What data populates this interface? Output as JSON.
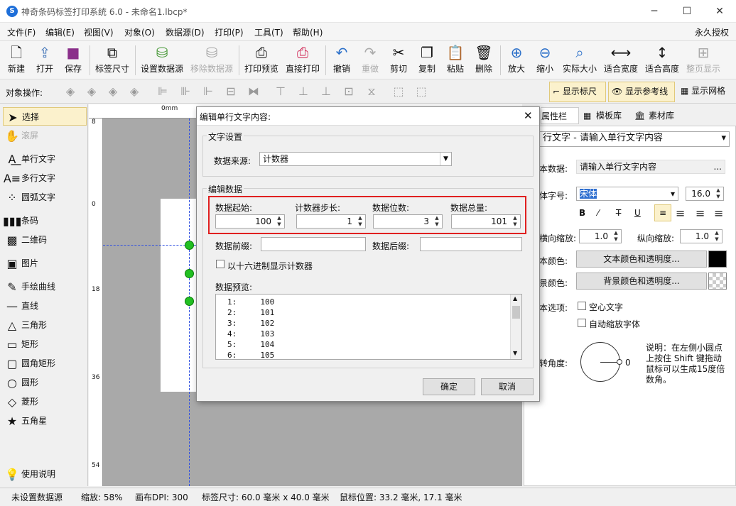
{
  "window": {
    "title": "神奇条码标签打印系统 6.0 - 未命名1.lbcp*",
    "icon": "app-logo-icon"
  },
  "menu": {
    "items": [
      "文件(F)",
      "编辑(E)",
      "视图(V)",
      "对象(O)",
      "数据源(D)",
      "打印(P)",
      "工具(T)",
      "帮助(H)"
    ],
    "right": "永久授权"
  },
  "toolbar": {
    "buttons": [
      {
        "label": "新建",
        "icon": "new-file-icon",
        "enabled": true
      },
      {
        "label": "打开",
        "icon": "open-icon",
        "enabled": true
      },
      {
        "label": "保存",
        "icon": "save-icon",
        "enabled": true
      },
      {
        "label": "标签尺寸",
        "icon": "label-size-icon",
        "enabled": true
      },
      {
        "label": "设置数据源",
        "icon": "database-icon",
        "enabled": true
      },
      {
        "label": "移除数据源",
        "icon": "database-remove-icon",
        "enabled": false
      },
      {
        "label": "打印预览",
        "icon": "print-preview-icon",
        "enabled": true
      },
      {
        "label": "直接打印",
        "icon": "printer-icon",
        "enabled": true
      },
      {
        "label": "撤销",
        "icon": "undo-icon",
        "enabled": true
      },
      {
        "label": "重做",
        "icon": "redo-icon",
        "enabled": false
      },
      {
        "label": "剪切",
        "icon": "cut-icon",
        "enabled": true
      },
      {
        "label": "复制",
        "icon": "copy-icon",
        "enabled": true
      },
      {
        "label": "粘贴",
        "icon": "paste-icon",
        "enabled": true
      },
      {
        "label": "删除",
        "icon": "delete-icon",
        "enabled": true
      },
      {
        "label": "放大",
        "icon": "zoom-in-icon",
        "enabled": true
      },
      {
        "label": "缩小",
        "icon": "zoom-out-icon",
        "enabled": true
      },
      {
        "label": "实际大小",
        "icon": "actual-size-icon",
        "enabled": true
      },
      {
        "label": "适合宽度",
        "icon": "fit-width-icon",
        "enabled": true
      },
      {
        "label": "适合高度",
        "icon": "fit-height-icon",
        "enabled": true
      },
      {
        "label": "整页显示",
        "icon": "full-page-icon",
        "enabled": false
      }
    ]
  },
  "objbar": {
    "label": "对象操作:",
    "show_ruler": "显示标尺",
    "show_guides": "显示参考线",
    "show_grid": "显示网格"
  },
  "tools": [
    {
      "label": "选择",
      "icon": "pointer-icon",
      "selected": true,
      "enabled": true
    },
    {
      "label": "滚屏",
      "icon": "hand-icon",
      "selected": false,
      "enabled": false
    },
    {
      "label": "单行文字",
      "icon": "single-line-text-icon"
    },
    {
      "label": "多行文字",
      "icon": "multi-line-text-icon"
    },
    {
      "label": "圆弧文字",
      "icon": "arc-text-icon"
    },
    {
      "label": "条码",
      "icon": "barcode-icon"
    },
    {
      "label": "二维码",
      "icon": "qrcode-icon"
    },
    {
      "label": "图片",
      "icon": "image-icon"
    },
    {
      "label": "手绘曲线",
      "icon": "pen-icon"
    },
    {
      "label": "直线",
      "icon": "line-icon"
    },
    {
      "label": "三角形",
      "icon": "triangle-icon"
    },
    {
      "label": "矩形",
      "icon": "rectangle-icon"
    },
    {
      "label": "圆角矩形",
      "icon": "rounded-rect-icon"
    },
    {
      "label": "圆形",
      "icon": "circle-icon"
    },
    {
      "label": "菱形",
      "icon": "diamond-icon"
    },
    {
      "label": "五角星",
      "icon": "star-icon"
    }
  ],
  "help": {
    "label": "使用说明",
    "icon": "lightbulb-icon"
  },
  "ruler": {
    "h_zero": "0mm",
    "v_labels": [
      "8",
      "0",
      "18",
      "36",
      "54"
    ]
  },
  "right_panel": {
    "tabs": [
      "属性栏",
      "模板库",
      "素材库"
    ],
    "object_select": "行文字 - 请输入单行文字内容",
    "text_data_label": "本数据:",
    "text_data": "请输入单行文字内容",
    "font_label": "体字号:",
    "font_value": "宋体",
    "font_size": "16.0",
    "hscale_label": "横向缩放:",
    "hscale": "1.0",
    "vscale_label": "纵向缩放:",
    "vscale": "1.0",
    "text_color_label": "本颜色:",
    "text_color_btn": "文本颜色和透明度...",
    "bg_color_label": "景颜色:",
    "bg_color_btn": "背景颜色和透明度...",
    "options_label": "本选项:",
    "hollow": "空心文字",
    "autoshrink": "自动缩放字体",
    "rotate_label": "转角度:",
    "rotate_value": "0",
    "note": "说明：在左侧小圆点上按住 Shift 键拖动鼠标可以生成15度倍数角。"
  },
  "dialog": {
    "title": "编辑单行文字内容:",
    "text_group": "文字设置",
    "source_label": "数据来源:",
    "source_value": "计数器",
    "edit_group": "编辑数据",
    "start_label": "数据起始:",
    "start": "100",
    "step_label": "计数器步长:",
    "step": "1",
    "digits_label": "数据位数:",
    "digits": "3",
    "total_label": "数据总量:",
    "total": "101",
    "prefix_label": "数据前缀:",
    "prefix": "",
    "suffix_label": "数据后缀:",
    "suffix": "",
    "hex_label": "以十六进制显示计数器",
    "preview_label": "数据预览:",
    "preview": [
      "1:     100",
      "2:     101",
      "3:     102",
      "4:     103",
      "5:     104",
      "6:     105"
    ],
    "ok": "确定",
    "cancel": "取消"
  },
  "status": {
    "datasource": "未设置数据源",
    "zoom": "缩放: 58%",
    "dpi": "画布DPI: 300",
    "size": "标签尺寸: 60.0 毫米 x 40.0 毫米",
    "pos": "鼠标位置: 33.2 毫米, 17.1 毫米"
  },
  "colors": {
    "highlight": "#e02020",
    "accent": "#1e6fd9",
    "toggle_bg": "#fbf1cc"
  }
}
